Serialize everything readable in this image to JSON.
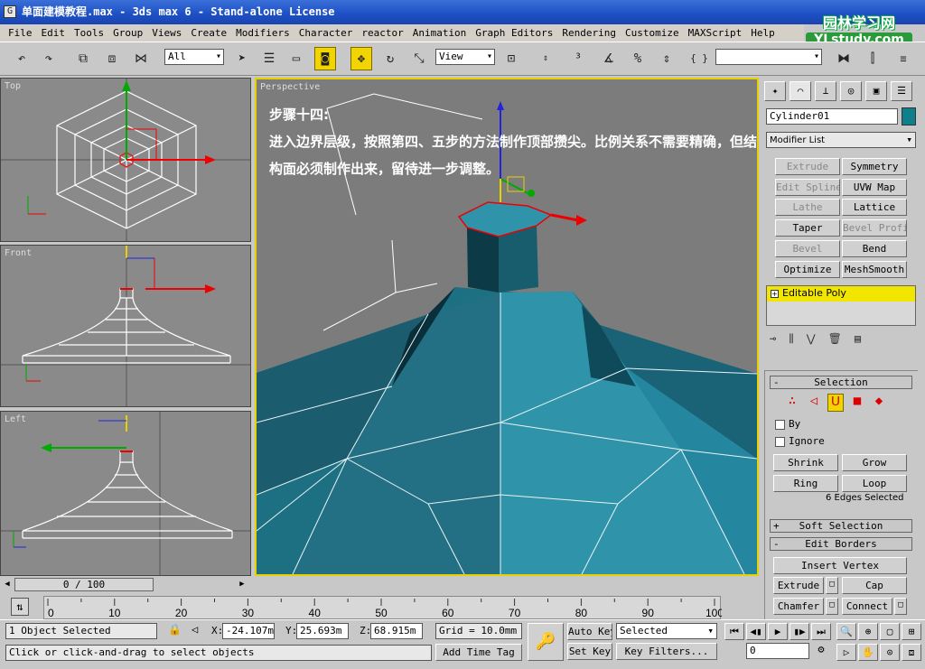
{
  "window": {
    "icon": "G",
    "title": "单面建模教程.max - 3ds max 6 - Stand-alone License",
    "watermark_line1": "园林学习网",
    "watermark_line2": "YLstudy.com"
  },
  "menu": [
    "File",
    "Edit",
    "Tools",
    "Group",
    "Views",
    "Create",
    "Modifiers",
    "Character",
    "reactor",
    "Animation",
    "Graph Editors",
    "Rendering",
    "Customize",
    "MAXScript",
    "Help"
  ],
  "toolbar": {
    "selection_filter": "All",
    "ref_coord": "View",
    "named_sel": "",
    "tools": {
      "undo": "↶",
      "redo": "↷",
      "link": "⧉",
      "unlink": "⧈",
      "bind": "⋈",
      "select": "➤",
      "select_name": "☰",
      "region": "▭",
      "window_crossing": "◙",
      "move": "✥",
      "rotate": "↻",
      "scale": "⤡",
      "pivot": "⊡",
      "snap3": "³",
      "snap_angle": "∡",
      "snap_pct": "%",
      "snap_spinner": "⇕",
      "named_sel_btn": "{ }",
      "mirror": "⧓",
      "align": "⫿"
    }
  },
  "viewports": {
    "top": "Top",
    "front": "Front",
    "left": "Left",
    "perspective": "Perspective"
  },
  "annotation": {
    "title": "步骤十四:",
    "body": "进入边界层级，按照第四、五步的方法制作顶部攒尖。比例关系不需要精确，但结构面必须制作出来，留待进一步调整。"
  },
  "command_panel": {
    "tab_icons": [
      "create-icon",
      "modify-icon",
      "hierarchy-icon",
      "motion-icon",
      "display-icon",
      "utilities-icon"
    ],
    "object_name": "Cylinder01",
    "object_color": "#0f7f8c",
    "modifier_list": "Modifier List",
    "modifier_buttons": [
      {
        "label": "Extrude",
        "enabled": false
      },
      {
        "label": "Symmetry",
        "enabled": true
      },
      {
        "label": "Edit Spline",
        "enabled": false
      },
      {
        "label": "UVW Map",
        "enabled": true
      },
      {
        "label": "Lathe",
        "enabled": false
      },
      {
        "label": "Lattice",
        "enabled": true
      },
      {
        "label": "Taper",
        "enabled": true
      },
      {
        "label": "Bevel Profile",
        "enabled": false
      },
      {
        "label": "Bevel",
        "enabled": false
      },
      {
        "label": "Bend",
        "enabled": true
      },
      {
        "label": "Optimize",
        "enabled": true
      },
      {
        "label": "MeshSmooth",
        "enabled": true
      }
    ],
    "stack_item": "Editable Poly",
    "selection_rollout": "Selection",
    "by_vertex": "By",
    "ignore_backfacing": "Ignore",
    "shrink": "Shrink",
    "grow": "Grow",
    "ring": "Ring",
    "loop": "Loop",
    "selection_info": "6 Edges Selected",
    "soft_selection": "Soft Selection",
    "edit_borders": "Edit Borders",
    "insert_vertex": "Insert Vertex",
    "extrude": "Extrude",
    "cap": "Cap",
    "chamfer": "Chamfer",
    "connect": "Connect"
  },
  "timeline": {
    "slider_label": "0 / 100",
    "ticks": [
      "0",
      "10",
      "20",
      "30",
      "40",
      "50",
      "60",
      "70",
      "80",
      "90",
      "100"
    ]
  },
  "status": {
    "selected": "1 Object Selected",
    "prompt": "Click or click-and-drag to select objects",
    "x_label": "X:",
    "x": "-24.107m",
    "y_label": "Y:",
    "y": "25.693m",
    "z_label": "Z:",
    "z": "68.915m",
    "grid": "Grid = 10.0mm",
    "add_time_tag": "Add Time Tag",
    "auto_key": "Auto Key",
    "set_key": "Set Key",
    "key_mode": "Selected",
    "key_filters": "Key Filters...",
    "frame": "0"
  },
  "colors": {
    "accent_yellow": "#f2d400",
    "title_blue": "#1d4fc4",
    "mesh_teal": "#1d6f82"
  }
}
